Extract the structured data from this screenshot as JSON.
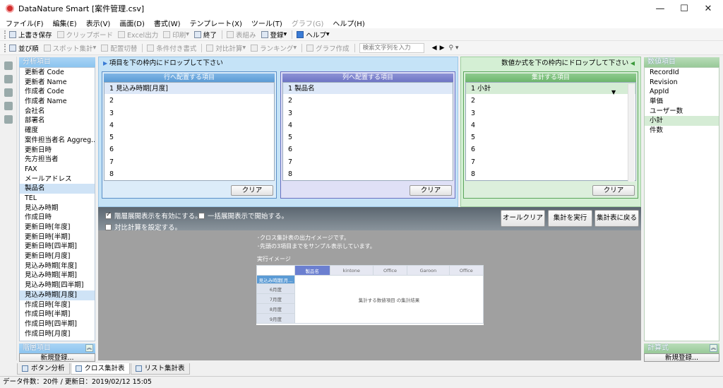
{
  "window": {
    "title": "DataNature Smart [案件管理.csv]",
    "minimize": "—",
    "maximize": "☐",
    "close": "✕"
  },
  "menu": [
    "ファイル(F)",
    "編集(E)",
    "表示(V)",
    "画面(D)",
    "書式(W)",
    "テンプレート(X)",
    "ツール(T)",
    "グラフ(G)",
    "ヘルプ(H)"
  ],
  "toolbar1": {
    "save": "上書き保存",
    "clipboard": "クリップボード",
    "excel": "Excel出力",
    "print": "印刷",
    "exit": "終了",
    "layout": "表組み",
    "register": "登録",
    "help": "ヘルプ"
  },
  "toolbar2": {
    "sort": "並び順",
    "spot": "スポット集計",
    "switch": "配置切替",
    "cond": "条件付き書式",
    "compare": "対比計算",
    "ranking": "ランキング",
    "graph": "グラフ作成",
    "search_placeholder": "検索文字列を入力"
  },
  "left_panel": {
    "title": "分析項目",
    "items": [
      "更新者 Code",
      "更新者 Name",
      "作成者 Code",
      "作成者 Name",
      "会社名",
      "部署名",
      "確度",
      "案件担当者名 Aggreg...",
      "更新日時",
      "先方担当者",
      "FAX",
      "メールアドレス",
      "製品名",
      "TEL",
      "見込み時期",
      "作成日時",
      "更新日時[年度]",
      "更新日時[半期]",
      "更新日時[四半期]",
      "更新日時[月度]",
      "見込み時期[年度]",
      "見込み時期[半期]",
      "見込み時期[四半期]",
      "見込み時期[月度]",
      "作成日時[年度]",
      "作成日時[半期]",
      "作成日時[四半期]",
      "作成日時[月度]"
    ],
    "hier_title": "階層項目",
    "register": "新規登録..."
  },
  "blue_zone": {
    "hint": "項目を下の枠内にドロップして下さい",
    "row_box": {
      "title": "行へ配置する項目",
      "rows": [
        "1  見込み時期[月度]",
        "2",
        "3",
        "4",
        "5",
        "6",
        "7",
        "8"
      ],
      "clear": "クリア"
    },
    "col_box": {
      "title": "列へ配置する項目",
      "rows": [
        "1  製品名",
        "2",
        "3",
        "4",
        "5",
        "6",
        "7",
        "8"
      ],
      "clear": "クリア"
    }
  },
  "green_zone": {
    "hint": "数値か式を下の枠内にドロップして下さい",
    "box": {
      "title": "集計する項目",
      "rows": [
        "1  小計",
        "2",
        "3",
        "4",
        "5",
        "6",
        "7",
        "8"
      ],
      "clear": "クリア"
    }
  },
  "right_panel": {
    "title": "数値項目",
    "items": [
      "RecordId",
      "Revision",
      "AppId",
      "単価",
      "ユーザー数",
      "小計",
      "件数"
    ],
    "calc_title": "計算式",
    "register": "新規登録..."
  },
  "options": {
    "hier": "階層展開表示を有効にする。",
    "expand": "一括展開表示で開始する。",
    "compare": "対比計算を設定する。",
    "allclear": "オールクリア",
    "run": "集計を実行",
    "back": "集計表に戻る"
  },
  "preview": {
    "note1": "･クロス集計表の出力イメージです。",
    "note2": "･先頭の3項目までをサンプル表示しています。",
    "label": "実行イメージ",
    "cols": [
      "製品名",
      "kintone",
      "Office",
      "Garoon",
      "Office"
    ],
    "rowhead": "見込み時期[月...",
    "rows": [
      "6月度",
      "7月度",
      "8月度",
      "9月度"
    ],
    "body": "集計する数値項目 の集計結果"
  },
  "tabs": [
    "ボタン分析",
    "クロス集計表",
    "リスト集計表"
  ],
  "status": "データ件数：20件  /  更新日：2019/02/12 15:05"
}
